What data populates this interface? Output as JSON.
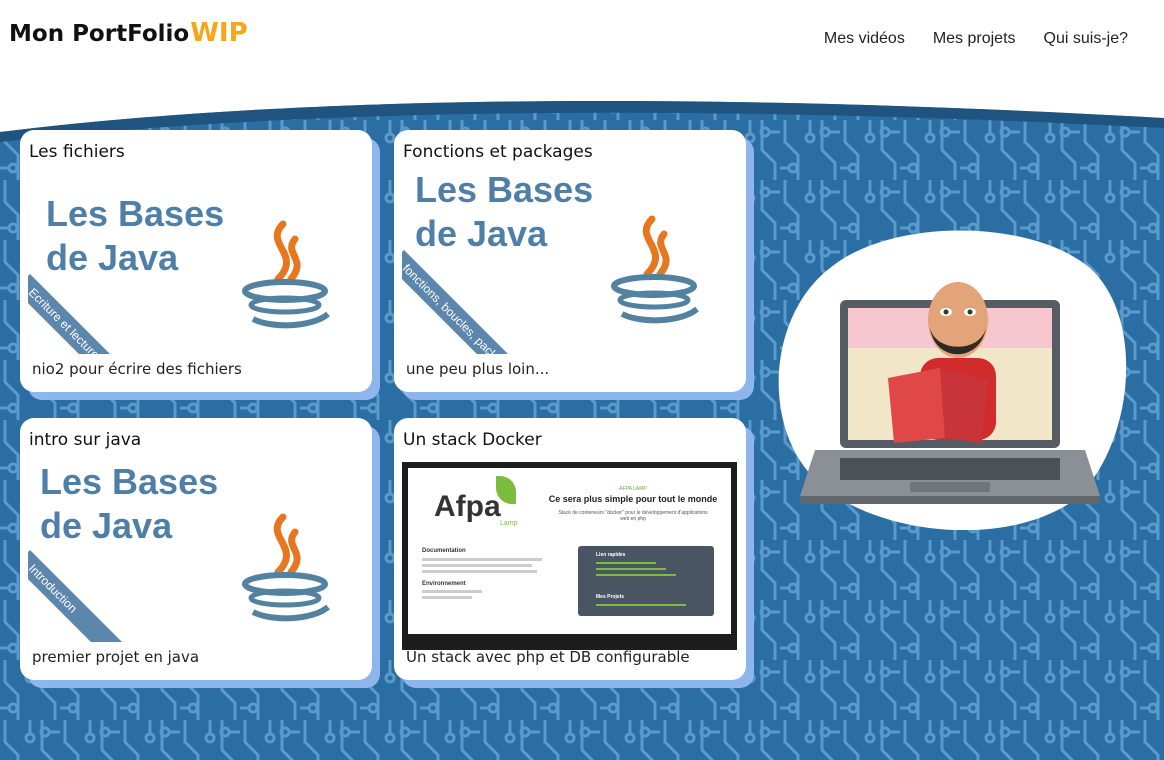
{
  "header": {
    "logo_text": "Mon PortFolio",
    "logo_badge": "WIP",
    "nav": [
      "Mes vidéos",
      "Mes projets",
      "Qui suis-je?"
    ]
  },
  "cards": [
    {
      "title": "Les fichiers",
      "thumb_title_line1": "Les Bases",
      "thumb_title_line2": "de Java",
      "ribbon": "Ecriture et lecture de fichiers",
      "desc": "nio2 pour écrire des fichiers"
    },
    {
      "title": "Fonctions et packages",
      "thumb_title_line1": "Les Bases",
      "thumb_title_line2": "de Java",
      "ribbon": "fonctions, boucles, packages...",
      "desc": "une peu plus loin..."
    },
    {
      "title": "intro sur java",
      "thumb_title_line1": "Les Bases",
      "thumb_title_line2": "de Java",
      "ribbon": "Introduction",
      "desc": "premier projet en java"
    },
    {
      "title": "Un stack Docker",
      "thumb_brand": "Afpa",
      "thumb_brand_sub": "Lamp",
      "thumb_small_header": "AFPA LAMP",
      "thumb_headline": "Ce sera plus simple pour tout le monde",
      "thumb_sub": "Stack de conteneurs \"docker\" pour le développement d'applications web en php",
      "thumb_doc_title": "Documentation",
      "thumb_env_title": "Environnement",
      "thumb_links_title": "Lien rapides",
      "thumb_projects_title": "Mes Projets",
      "desc": "Un stack avec php et DB configurable"
    }
  ],
  "colors": {
    "accent": "#f4a71c",
    "background_blue": "#2a6fa6",
    "card_shadow": "#8fb6ec",
    "java_blue": "#4f7fa6"
  }
}
